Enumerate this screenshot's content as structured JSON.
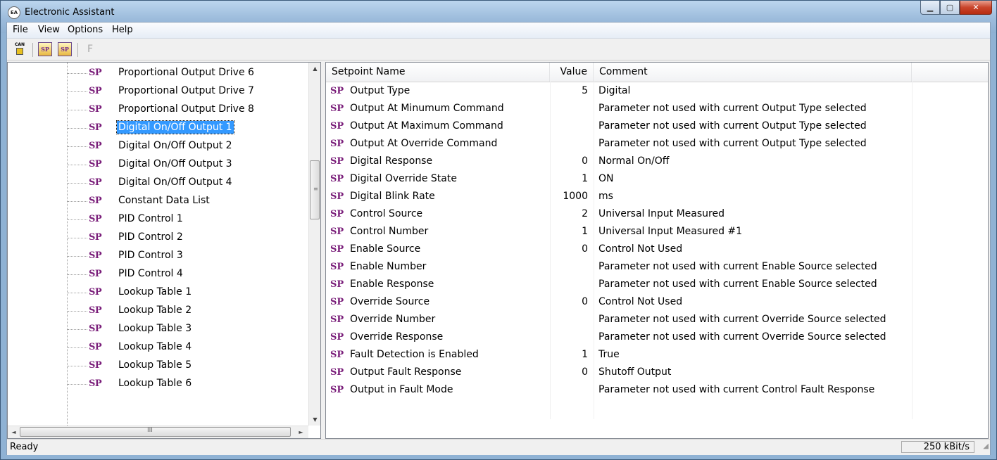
{
  "window": {
    "title": "Electronic Assistant",
    "app_icon": "EA"
  },
  "menu": [
    "File",
    "View",
    "Options",
    "Help"
  ],
  "toolbar": {
    "buttons": [
      {
        "name": "can-connect-icon",
        "label": "CAN"
      },
      {
        "name": "open-setpoint-file-icon",
        "label": "SP"
      },
      {
        "name": "save-setpoint-file-icon",
        "label": "SP"
      },
      {
        "name": "flash-icon",
        "label": "F"
      }
    ]
  },
  "tree": {
    "sp_glyph": "SP",
    "items": [
      "Proportional Output Drive 6",
      "Proportional Output Drive 7",
      "Proportional Output Drive 8",
      "Digital On/Off Output 1",
      "Digital On/Off Output 2",
      "Digital On/Off Output 3",
      "Digital On/Off Output 4",
      "Constant Data List",
      "PID Control 1",
      "PID Control 2",
      "PID Control 3",
      "PID Control 4",
      "Lookup Table 1",
      "Lookup Table 2",
      "Lookup Table 3",
      "Lookup Table 4",
      "Lookup Table 5",
      "Lookup Table 6"
    ],
    "selected_index": 3,
    "scroll_arrows": {
      "up": "▲",
      "down": "▼",
      "left": "◄",
      "right": "►",
      "grip": "III"
    }
  },
  "table": {
    "columns": [
      "Setpoint Name",
      "Value",
      "Comment"
    ],
    "row_glyph": "SP",
    "rows": [
      {
        "name": "Output Type",
        "value": "5",
        "comment": "Digital"
      },
      {
        "name": "Output At Minumum Command",
        "value": "",
        "comment": "Parameter not used with current Output Type selected"
      },
      {
        "name": "Output At Maximum Command",
        "value": "",
        "comment": "Parameter not used with current Output Type selected"
      },
      {
        "name": "Output At Override Command",
        "value": "",
        "comment": "Parameter not used with current Output Type selected"
      },
      {
        "name": "Digital Response",
        "value": "0",
        "comment": "Normal On/Off"
      },
      {
        "name": "Digital Override State",
        "value": "1",
        "comment": "ON"
      },
      {
        "name": "Digital Blink Rate",
        "value": "1000",
        "comment": "ms"
      },
      {
        "name": "Control Source",
        "value": "2",
        "comment": "Universal Input Measured"
      },
      {
        "name": "Control Number",
        "value": "1",
        "comment": "Universal Input Measured #1"
      },
      {
        "name": "Enable Source",
        "value": "0",
        "comment": "Control Not Used"
      },
      {
        "name": "Enable Number",
        "value": "",
        "comment": "Parameter not used with current Enable Source selected"
      },
      {
        "name": "Enable Response",
        "value": "",
        "comment": "Parameter not used with current Enable Source selected"
      },
      {
        "name": "Override Source",
        "value": "0",
        "comment": "Control Not Used"
      },
      {
        "name": "Override Number",
        "value": "",
        "comment": "Parameter not used with current Override Source selected"
      },
      {
        "name": "Override Response",
        "value": "",
        "comment": "Parameter not used with current Override Source selected"
      },
      {
        "name": "Fault Detection is Enabled",
        "value": "1",
        "comment": "True"
      },
      {
        "name": "Output Fault Response",
        "value": "0",
        "comment": "Shutoff Output"
      },
      {
        "name": "Output in Fault Mode",
        "value": "",
        "comment": "Parameter not used with current Control Fault Response"
      }
    ]
  },
  "status": {
    "text": "Ready",
    "baud": "250 kBit/s"
  },
  "colors": {
    "selection": "#3399ff",
    "sp_glyph": "#7a1e7a",
    "close_button": "#c9452c"
  }
}
